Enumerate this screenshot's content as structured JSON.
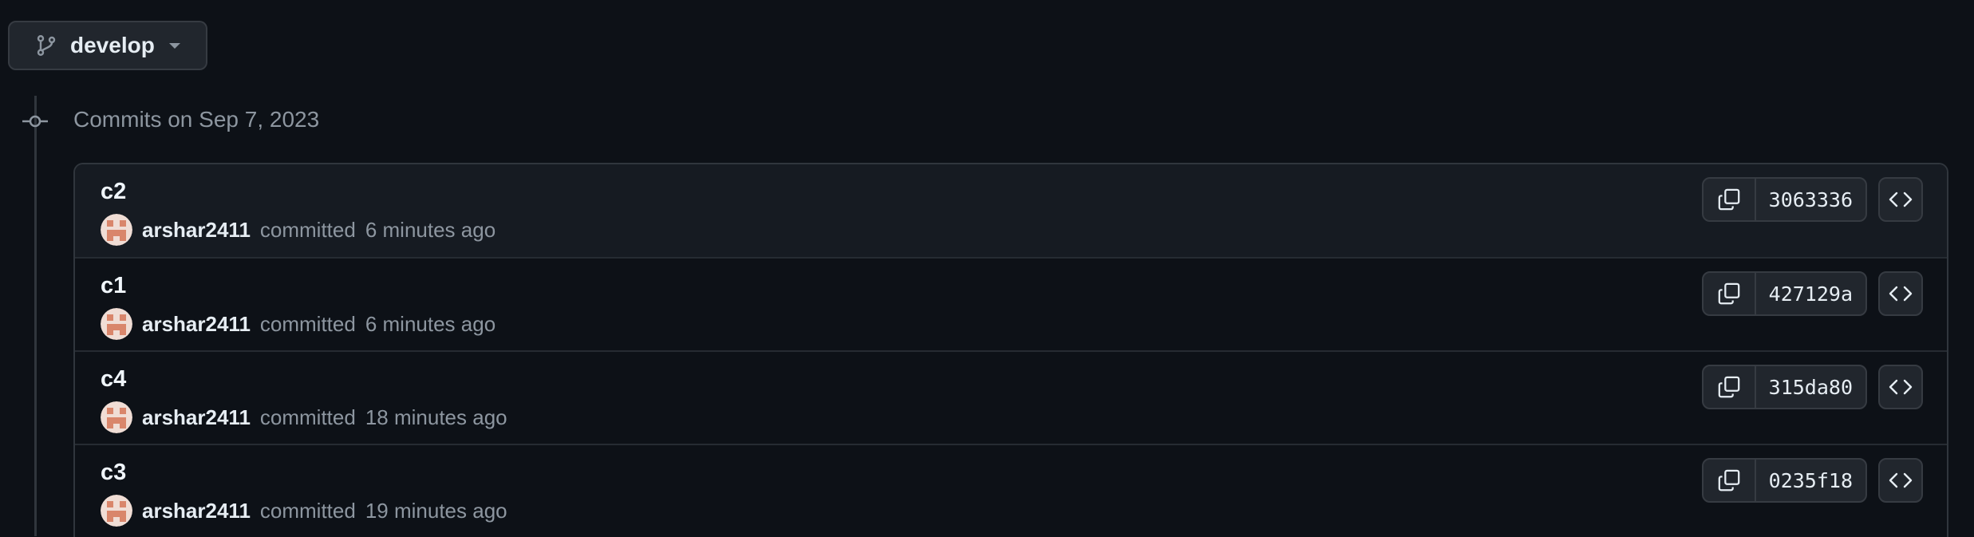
{
  "branch": {
    "name": "develop",
    "icon": "git-branch-icon"
  },
  "group": {
    "title": "Commits on Sep 7, 2023"
  },
  "commits": [
    {
      "title": "c2",
      "author": "arshar2411",
      "action": "committed",
      "time": "6 minutes ago",
      "sha": "3063336"
    },
    {
      "title": "c1",
      "author": "arshar2411",
      "action": "committed",
      "time": "6 minutes ago",
      "sha": "427129a"
    },
    {
      "title": "c4",
      "author": "arshar2411",
      "action": "committed",
      "time": "18 minutes ago",
      "sha": "315da80"
    },
    {
      "title": "c3",
      "author": "arshar2411",
      "action": "committed",
      "time": "19 minutes ago",
      "sha": "0235f18"
    }
  ],
  "colors": {
    "background": "#0d1117",
    "button": "#21262d",
    "border": "#30363d",
    "muted": "#8d96a0",
    "avatar": "#d9866b"
  }
}
